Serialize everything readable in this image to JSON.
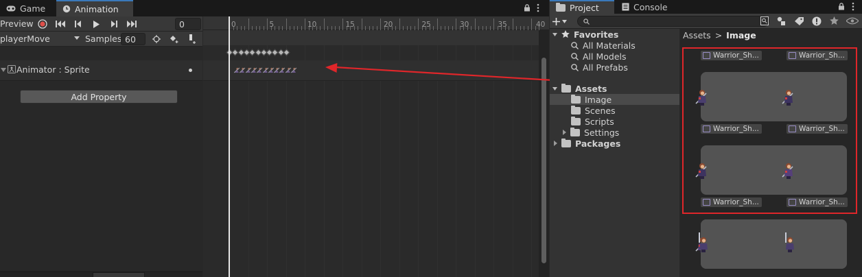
{
  "tabs": {
    "game": "Game",
    "animation": "Animation"
  },
  "toolbar": {
    "preview": "Preview",
    "frame": "0"
  },
  "clip": {
    "name": "playerMove",
    "samples_label": "Samples",
    "samples": "60"
  },
  "property": {
    "label": "Animator : Sprite",
    "add_button": "Add Property"
  },
  "timeline": {
    "ticks": [
      "0",
      "5",
      "10",
      "15",
      "20",
      "25",
      "30",
      "35",
      "40"
    ]
  },
  "project": {
    "tabs": {
      "project": "Project",
      "console": "Console"
    },
    "favorites": {
      "title": "Favorites",
      "items": [
        "All Materials",
        "All Models",
        "All Prefabs"
      ]
    },
    "assets": {
      "title": "Assets",
      "items": [
        "Image",
        "Scenes",
        "Scripts",
        "Settings"
      ]
    },
    "packages": "Packages",
    "breadcrumb": {
      "root": "Assets",
      "separator": ">",
      "current": "Image"
    },
    "asset_label": "Warrior_Sh..."
  },
  "colors": {
    "accent": "#3a79bb",
    "highlight": "#e0262a",
    "record": "#e0504a"
  }
}
